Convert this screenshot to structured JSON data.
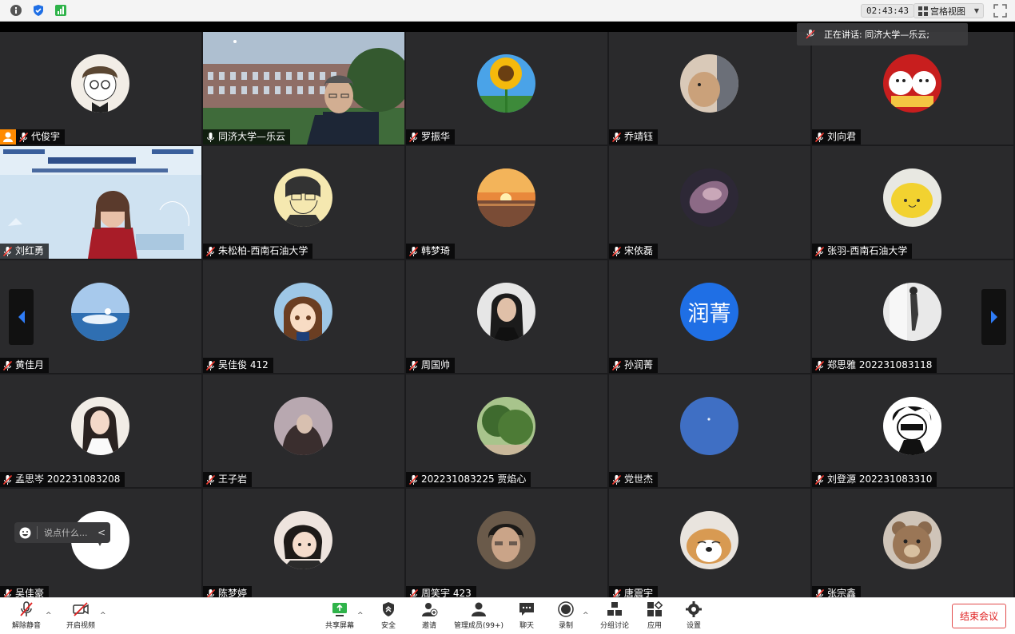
{
  "topbar": {
    "icons": [
      "info-icon",
      "shield-icon",
      "signal-icon"
    ],
    "timer": "02:43:43",
    "view_label": "宫格视图",
    "fullscreen_icon": "fullscreen-icon"
  },
  "speaking": {
    "label": "正在讲话: 同济大学—乐云;"
  },
  "participants": [
    {
      "name": "代俊宇",
      "avatar": "cartoon-boy",
      "host": true
    },
    {
      "name": "同济大学—乐云",
      "video": "campus",
      "active": true,
      "mic_on": true
    },
    {
      "name": "罗振华",
      "avatar": "sunflower"
    },
    {
      "name": "乔靖钰",
      "avatar": "dog-window"
    },
    {
      "name": "刘向君",
      "avatar": "lucky-cats"
    },
    {
      "name": "刘红勇",
      "video": "slide"
    },
    {
      "name": "朱松柏-西南石油大学",
      "avatar": "sketch-man"
    },
    {
      "name": "韩梦琦",
      "avatar": "sunset"
    },
    {
      "name": "宋依磊",
      "avatar": "nebula"
    },
    {
      "name": "张羽-西南石油大学",
      "avatar": "yellow-blob"
    },
    {
      "name": "黄佳月",
      "avatar": "sea-girl"
    },
    {
      "name": "吴佳俊 412",
      "avatar": "anime-girl"
    },
    {
      "name": "周国帅",
      "avatar": "woman-portrait"
    },
    {
      "name": "孙润菁",
      "avatar_text": "润菁"
    },
    {
      "name": "郑思雅 202231083118",
      "avatar": "gym-mirror"
    },
    {
      "name": "孟思岑 202231083208",
      "avatar": "woman-white"
    },
    {
      "name": "王子岩",
      "avatar": "girl-hair"
    },
    {
      "name": "202231083225 贾焰心",
      "avatar": "tree"
    },
    {
      "name": "党世杰",
      "avatar": "blue-sky"
    },
    {
      "name": "刘登源 202231083310",
      "avatar": "cartoon-bw"
    },
    {
      "name": "吴佳豪",
      "avatar": "white-circle"
    },
    {
      "name": "陈梦婷",
      "avatar": "baby-girl"
    },
    {
      "name": "周笑宇 423",
      "avatar": "man-face"
    },
    {
      "name": "唐震宇",
      "avatar": "shiba"
    },
    {
      "name": "张宗鑫",
      "avatar": "bear"
    }
  ],
  "chat": {
    "placeholder": "说点什么..."
  },
  "toolbar": {
    "unmute": "解除静音",
    "start_video": "开启视频",
    "share_screen": "共享屏幕",
    "security": "安全",
    "invite": "邀请",
    "manage_members": "管理成员(99+)",
    "chat": "聊天",
    "record": "录制",
    "breakout": "分组讨论",
    "apps": "应用",
    "settings": "设置",
    "end_meeting": "结束会议"
  },
  "colors": {
    "active_border": "#35c759",
    "end_red": "#e02020",
    "host_orange": "#ff8a00",
    "avatar_blue": "#1f6fe5"
  }
}
